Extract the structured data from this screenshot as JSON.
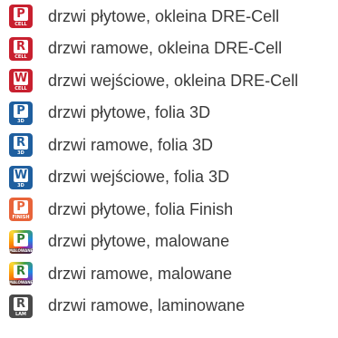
{
  "legend": {
    "items": [
      {
        "letter": "P",
        "tag": "CELL",
        "label": "drzwi płytowe, okleina DRE-Cell",
        "color": "#c8202f",
        "icon": "door-panel-cell-icon"
      },
      {
        "letter": "R",
        "tag": "CELL",
        "label": "drzwi ramowe, okleina DRE-Cell",
        "color": "#c8202f",
        "icon": "door-frame-cell-icon"
      },
      {
        "letter": "W",
        "tag": "CELL",
        "label": "drzwi wejściowe, okleina DRE-Cell",
        "color": "#c8202f",
        "icon": "door-entrance-cell-icon"
      },
      {
        "letter": "P",
        "tag": "3D",
        "label": "drzwi płytowe, folia 3D",
        "color": "#1f5f9f",
        "icon": "door-panel-3d-icon"
      },
      {
        "letter": "R",
        "tag": "3D",
        "label": "drzwi ramowe, folia 3D",
        "color": "#1f5f9f",
        "icon": "door-frame-3d-icon"
      },
      {
        "letter": "W",
        "tag": "3D",
        "label": "drzwi wejściowe, folia 3D",
        "color": "#1f5f9f",
        "icon": "door-entrance-3d-icon"
      },
      {
        "letter": "P",
        "tag": "FINISH",
        "label": "drzwi płytowe, folia Finish",
        "color": "#e8643a",
        "icon": "door-panel-finish-icon"
      },
      {
        "letter": "P",
        "tag": "MALOWANE",
        "label": "drzwi płytowe, malowane",
        "color": "rainbow",
        "icon": "door-panel-painted-icon"
      },
      {
        "letter": "R",
        "tag": "MALOWANE",
        "label": "drzwi ramowe, malowane",
        "color": "rainbow",
        "icon": "door-frame-painted-icon"
      },
      {
        "letter": "R",
        "tag": "LAM",
        "label": "drzwi ramowe, laminowane",
        "color": "#4a4a4a",
        "icon": "door-frame-laminated-icon"
      }
    ]
  }
}
